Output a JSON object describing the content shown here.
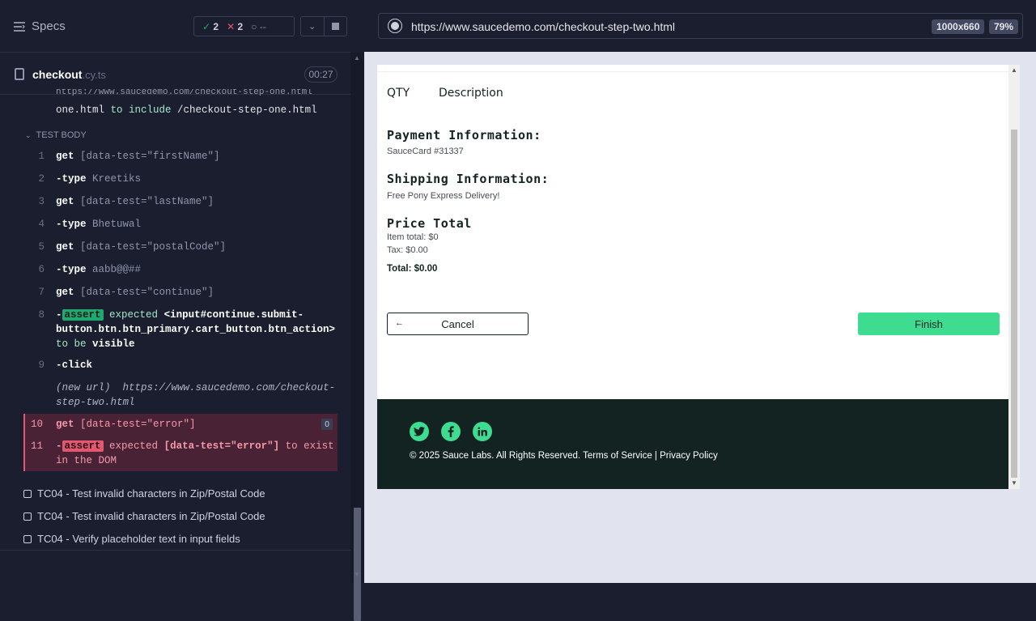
{
  "runner": {
    "specs_label": "Specs",
    "stats": {
      "passed": "2",
      "failed": "2",
      "pending": "--"
    },
    "file": {
      "name": "checkout",
      "ext": ".cy.ts",
      "duration": "00:27"
    },
    "previous_line": {
      "text": "https://www.saucedemo.com/checkout-step-one.html",
      "mid": "to include",
      "tail": "/checkout-step-one.html"
    },
    "test_body_label": "TEST BODY",
    "commands": [
      {
        "num": "1",
        "name": "get",
        "msg": "[data-test=\"firstName\"]"
      },
      {
        "num": "2",
        "name": "-type",
        "msg": "Kreetiks"
      },
      {
        "num": "3",
        "name": "get",
        "msg": "[data-test=\"lastName\"]"
      },
      {
        "num": "4",
        "name": "-type",
        "msg": "Bhetuwal"
      },
      {
        "num": "5",
        "name": "get",
        "msg": "[data-test=\"postalCode\"]"
      },
      {
        "num": "6",
        "name": "-type",
        "msg": "aabb@@##"
      },
      {
        "num": "7",
        "name": "get",
        "msg": "[data-test=\"continue\"]"
      },
      {
        "num": "8",
        "name": "assert",
        "prefix": "-",
        "msg": "expected",
        "subject": "<input#continue.submit-button.btn.btn_primary.cart_button.btn_action>",
        "verb": "to be",
        "obj": "visible"
      },
      {
        "num": "9",
        "name": "-click",
        "msg": ""
      },
      {
        "num": "10",
        "name": "get",
        "msg": "[data-test=\"error\"]",
        "badge": "0"
      },
      {
        "num": "11",
        "name": "assert",
        "prefix": "-",
        "msg": "expected",
        "subject": "[data-test=\"error\"]",
        "verb": "to exist",
        "obj": "in the DOM"
      }
    ],
    "new_url": {
      "label": "(new url)",
      "url": "https://www.saucedemo.com/checkout-step-two.html"
    },
    "tests": [
      "TC04 - Test invalid characters in Zip/Postal Code",
      "TC04 - Test invalid characters in Zip/Postal Code",
      "TC04 - Verify placeholder text in input fields"
    ]
  },
  "browser": {
    "url": "https://www.saucedemo.com/checkout-step-two.html",
    "viewport": "1000x660",
    "zoom": "79%"
  },
  "app": {
    "header": {
      "qty": "QTY",
      "description": "Description"
    },
    "payment_label": "Payment Information:",
    "payment_value": "SauceCard #31337",
    "shipping_label": "Shipping Information:",
    "shipping_value": "Free Pony Express Delivery!",
    "price_label": "Price Total",
    "item_total": "Item total: $0",
    "tax": "Tax: $0.00",
    "total": "Total: $0.00",
    "cancel_label": "Cancel",
    "finish_label": "Finish",
    "footer_copy": "© 2025 Sauce Labs. All Rights Reserved. Terms of Service | Privacy Policy"
  },
  "colors": {
    "brand_green": "#3ddc91",
    "fail_red": "#e45770",
    "pass_green": "#1fa971",
    "footer_bg": "#132322"
  }
}
